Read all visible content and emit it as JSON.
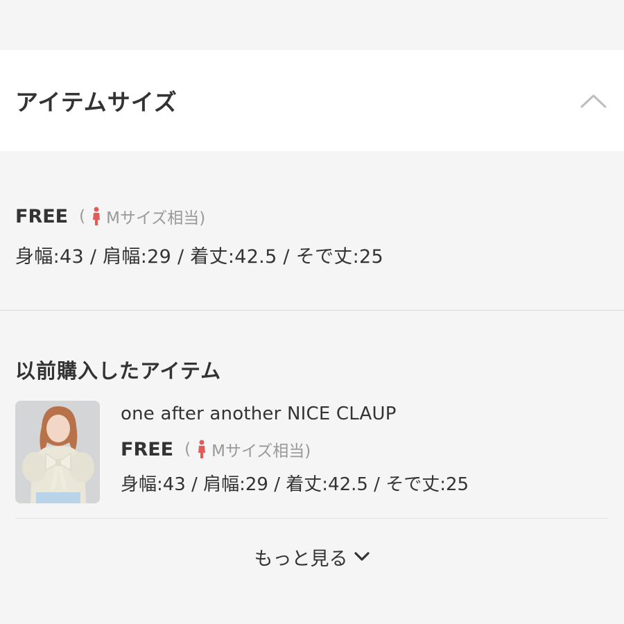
{
  "accordion": {
    "title": "アイテムサイズ",
    "toggle_icon": "chevron-up-icon"
  },
  "size": {
    "name": "FREE",
    "equiv_open": "(",
    "equiv_label": "Mサイズ相当)",
    "person_icon": "person-icon",
    "accent_color": "#e25b5b",
    "measurements": "身幅:43 / 肩幅:29 / 着丈:42.5 / そで丈:25"
  },
  "history": {
    "title": "以前購入したアイテム",
    "items": [
      {
        "name": "one after another NICE CLAUP",
        "size_name": "FREE",
        "equiv_open": "(",
        "equiv_label": "Mサイズ相当)",
        "measurements": "身幅:43 / 肩幅:29 / 着丈:42.5 / そで丈:25"
      }
    ],
    "more_label": "もっと見る",
    "more_icon": "chevron-down-icon"
  }
}
